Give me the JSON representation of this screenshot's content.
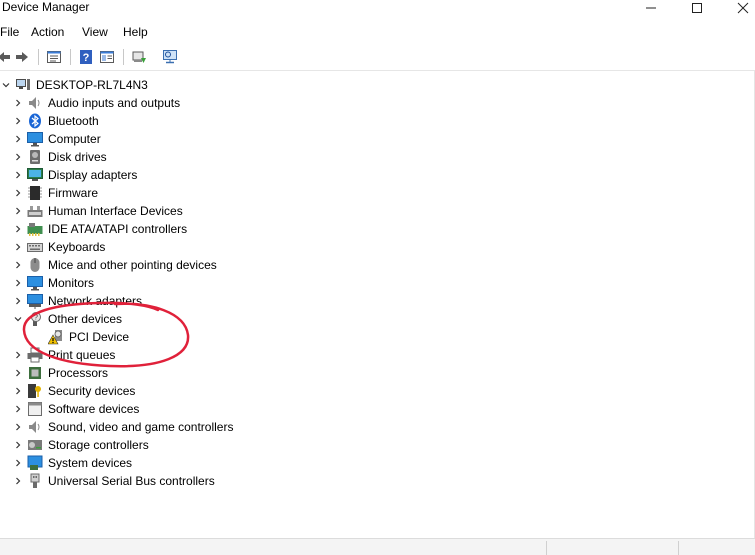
{
  "window": {
    "title": "Device Manager"
  },
  "menu": [
    "File",
    "Action",
    "View",
    "Help"
  ],
  "toolbar": [
    "back-icon",
    "forward-icon",
    "properties-icon",
    "help-icon",
    "show-hide-console-tree-icon",
    "update-driver-icon",
    "scan-hardware-icon"
  ],
  "tree": {
    "root": "DESKTOP-RL7L4N3",
    "categories": [
      "Audio inputs and outputs",
      "Bluetooth",
      "Computer",
      "Disk drives",
      "Display adapters",
      "Firmware",
      "Human Interface Devices",
      "IDE ATA/ATAPI controllers",
      "Keyboards",
      "Mice and other pointing devices",
      "Monitors",
      "Network adapters",
      "Other devices",
      "Print queues",
      "Processors",
      "Security devices",
      "Software devices",
      "Sound, video and game controllers",
      "Storage controllers",
      "System devices",
      "Universal Serial Bus controllers"
    ],
    "other_devices_children": [
      "PCI Device"
    ]
  },
  "colors": {
    "annotation": "#e0213a",
    "accent": "#1e6fd0"
  }
}
